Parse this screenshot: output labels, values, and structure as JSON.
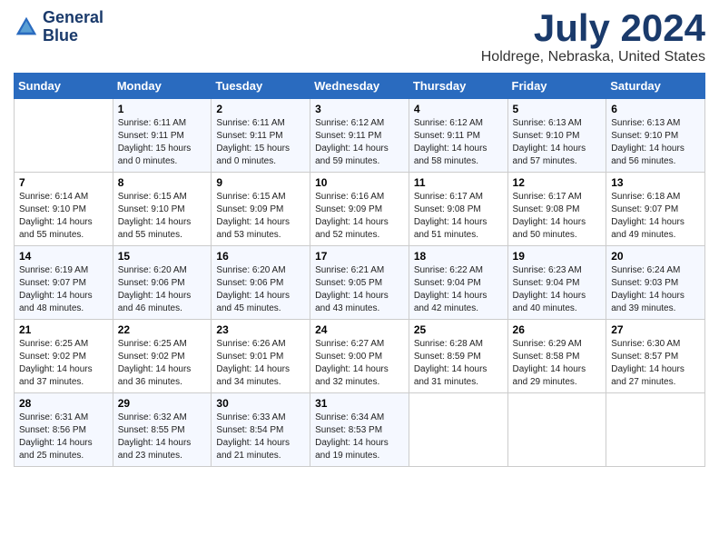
{
  "header": {
    "logo_line1": "General",
    "logo_line2": "Blue",
    "month_year": "July 2024",
    "location": "Holdrege, Nebraska, United States"
  },
  "weekdays": [
    "Sunday",
    "Monday",
    "Tuesday",
    "Wednesday",
    "Thursday",
    "Friday",
    "Saturday"
  ],
  "weeks": [
    [
      {
        "day": "",
        "sunrise": "",
        "sunset": "",
        "daylight": ""
      },
      {
        "day": "1",
        "sunrise": "Sunrise: 6:11 AM",
        "sunset": "Sunset: 9:11 PM",
        "daylight": "Daylight: 15 hours and 0 minutes."
      },
      {
        "day": "2",
        "sunrise": "Sunrise: 6:11 AM",
        "sunset": "Sunset: 9:11 PM",
        "daylight": "Daylight: 15 hours and 0 minutes."
      },
      {
        "day": "3",
        "sunrise": "Sunrise: 6:12 AM",
        "sunset": "Sunset: 9:11 PM",
        "daylight": "Daylight: 14 hours and 59 minutes."
      },
      {
        "day": "4",
        "sunrise": "Sunrise: 6:12 AM",
        "sunset": "Sunset: 9:11 PM",
        "daylight": "Daylight: 14 hours and 58 minutes."
      },
      {
        "day": "5",
        "sunrise": "Sunrise: 6:13 AM",
        "sunset": "Sunset: 9:10 PM",
        "daylight": "Daylight: 14 hours and 57 minutes."
      },
      {
        "day": "6",
        "sunrise": "Sunrise: 6:13 AM",
        "sunset": "Sunset: 9:10 PM",
        "daylight": "Daylight: 14 hours and 56 minutes."
      }
    ],
    [
      {
        "day": "7",
        "sunrise": "Sunrise: 6:14 AM",
        "sunset": "Sunset: 9:10 PM",
        "daylight": "Daylight: 14 hours and 55 minutes."
      },
      {
        "day": "8",
        "sunrise": "Sunrise: 6:15 AM",
        "sunset": "Sunset: 9:10 PM",
        "daylight": "Daylight: 14 hours and 55 minutes."
      },
      {
        "day": "9",
        "sunrise": "Sunrise: 6:15 AM",
        "sunset": "Sunset: 9:09 PM",
        "daylight": "Daylight: 14 hours and 53 minutes."
      },
      {
        "day": "10",
        "sunrise": "Sunrise: 6:16 AM",
        "sunset": "Sunset: 9:09 PM",
        "daylight": "Daylight: 14 hours and 52 minutes."
      },
      {
        "day": "11",
        "sunrise": "Sunrise: 6:17 AM",
        "sunset": "Sunset: 9:08 PM",
        "daylight": "Daylight: 14 hours and 51 minutes."
      },
      {
        "day": "12",
        "sunrise": "Sunrise: 6:17 AM",
        "sunset": "Sunset: 9:08 PM",
        "daylight": "Daylight: 14 hours and 50 minutes."
      },
      {
        "day": "13",
        "sunrise": "Sunrise: 6:18 AM",
        "sunset": "Sunset: 9:07 PM",
        "daylight": "Daylight: 14 hours and 49 minutes."
      }
    ],
    [
      {
        "day": "14",
        "sunrise": "Sunrise: 6:19 AM",
        "sunset": "Sunset: 9:07 PM",
        "daylight": "Daylight: 14 hours and 48 minutes."
      },
      {
        "day": "15",
        "sunrise": "Sunrise: 6:20 AM",
        "sunset": "Sunset: 9:06 PM",
        "daylight": "Daylight: 14 hours and 46 minutes."
      },
      {
        "day": "16",
        "sunrise": "Sunrise: 6:20 AM",
        "sunset": "Sunset: 9:06 PM",
        "daylight": "Daylight: 14 hours and 45 minutes."
      },
      {
        "day": "17",
        "sunrise": "Sunrise: 6:21 AM",
        "sunset": "Sunset: 9:05 PM",
        "daylight": "Daylight: 14 hours and 43 minutes."
      },
      {
        "day": "18",
        "sunrise": "Sunrise: 6:22 AM",
        "sunset": "Sunset: 9:04 PM",
        "daylight": "Daylight: 14 hours and 42 minutes."
      },
      {
        "day": "19",
        "sunrise": "Sunrise: 6:23 AM",
        "sunset": "Sunset: 9:04 PM",
        "daylight": "Daylight: 14 hours and 40 minutes."
      },
      {
        "day": "20",
        "sunrise": "Sunrise: 6:24 AM",
        "sunset": "Sunset: 9:03 PM",
        "daylight": "Daylight: 14 hours and 39 minutes."
      }
    ],
    [
      {
        "day": "21",
        "sunrise": "Sunrise: 6:25 AM",
        "sunset": "Sunset: 9:02 PM",
        "daylight": "Daylight: 14 hours and 37 minutes."
      },
      {
        "day": "22",
        "sunrise": "Sunrise: 6:25 AM",
        "sunset": "Sunset: 9:02 PM",
        "daylight": "Daylight: 14 hours and 36 minutes."
      },
      {
        "day": "23",
        "sunrise": "Sunrise: 6:26 AM",
        "sunset": "Sunset: 9:01 PM",
        "daylight": "Daylight: 14 hours and 34 minutes."
      },
      {
        "day": "24",
        "sunrise": "Sunrise: 6:27 AM",
        "sunset": "Sunset: 9:00 PM",
        "daylight": "Daylight: 14 hours and 32 minutes."
      },
      {
        "day": "25",
        "sunrise": "Sunrise: 6:28 AM",
        "sunset": "Sunset: 8:59 PM",
        "daylight": "Daylight: 14 hours and 31 minutes."
      },
      {
        "day": "26",
        "sunrise": "Sunrise: 6:29 AM",
        "sunset": "Sunset: 8:58 PM",
        "daylight": "Daylight: 14 hours and 29 minutes."
      },
      {
        "day": "27",
        "sunrise": "Sunrise: 6:30 AM",
        "sunset": "Sunset: 8:57 PM",
        "daylight": "Daylight: 14 hours and 27 minutes."
      }
    ],
    [
      {
        "day": "28",
        "sunrise": "Sunrise: 6:31 AM",
        "sunset": "Sunset: 8:56 PM",
        "daylight": "Daylight: 14 hours and 25 minutes."
      },
      {
        "day": "29",
        "sunrise": "Sunrise: 6:32 AM",
        "sunset": "Sunset: 8:55 PM",
        "daylight": "Daylight: 14 hours and 23 minutes."
      },
      {
        "day": "30",
        "sunrise": "Sunrise: 6:33 AM",
        "sunset": "Sunset: 8:54 PM",
        "daylight": "Daylight: 14 hours and 21 minutes."
      },
      {
        "day": "31",
        "sunrise": "Sunrise: 6:34 AM",
        "sunset": "Sunset: 8:53 PM",
        "daylight": "Daylight: 14 hours and 19 minutes."
      },
      {
        "day": "",
        "sunrise": "",
        "sunset": "",
        "daylight": ""
      },
      {
        "day": "",
        "sunrise": "",
        "sunset": "",
        "daylight": ""
      },
      {
        "day": "",
        "sunrise": "",
        "sunset": "",
        "daylight": ""
      }
    ]
  ]
}
